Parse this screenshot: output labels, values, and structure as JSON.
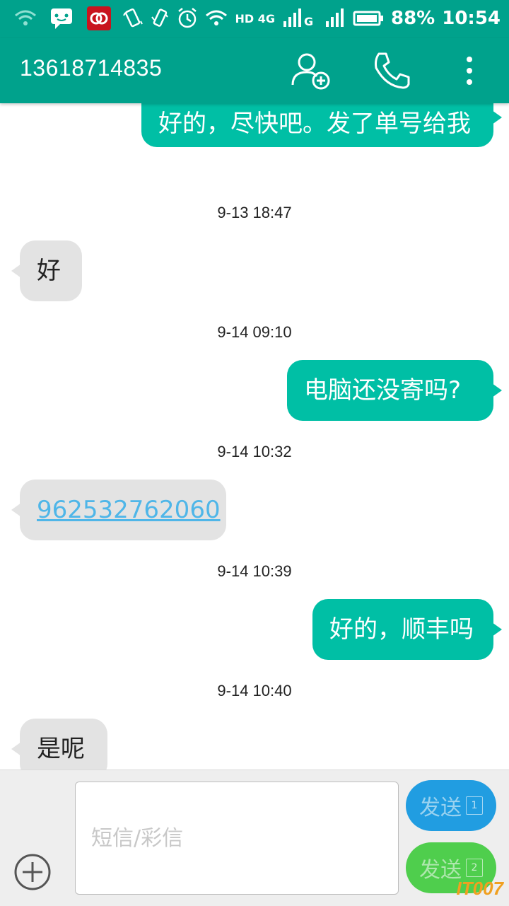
{
  "status_bar": {
    "network_label": "HD 4G",
    "battery_percent": "88%",
    "time": "10:54"
  },
  "app_bar": {
    "contact_number": "13618714835",
    "icons": [
      "add-contact-icon",
      "phone-icon",
      "more-vert-icon"
    ]
  },
  "messages": [
    {
      "type": "sent",
      "text": "好的，尽快吧。发了单号给我"
    },
    {
      "type": "time",
      "text": "9-13 18:47"
    },
    {
      "type": "received",
      "text": "好"
    },
    {
      "type": "time",
      "text": "9-14 09:10"
    },
    {
      "type": "sent",
      "text": "电脑还没寄吗?"
    },
    {
      "type": "time",
      "text": "9-14 10:32"
    },
    {
      "type": "received",
      "text": "962532762060",
      "is_link": true
    },
    {
      "type": "time",
      "text": "9-14 10:39"
    },
    {
      "type": "sent",
      "text": "好的，顺丰吗"
    },
    {
      "type": "time",
      "text": "9-14 10:40"
    },
    {
      "type": "received",
      "text": "是呢"
    }
  ],
  "compose": {
    "placeholder": "短信/彩信",
    "value": "",
    "send_sim1_label": "发送",
    "send_sim1_badge": "1",
    "send_sim2_label": "发送",
    "send_sim2_badge": "2"
  },
  "watermark": "IT007",
  "colors": {
    "header": "#00a28c",
    "sent_bubble": "#00bfa5",
    "received_bubble": "#e3e3e3",
    "link": "#4fb6e8",
    "send_sim1": "#0b95e0",
    "send_sim2": "#3ecb3c"
  }
}
